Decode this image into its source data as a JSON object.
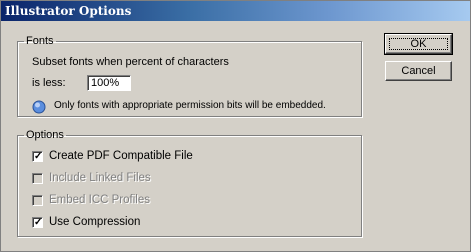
{
  "window": {
    "title": "Illustrator Options"
  },
  "fonts": {
    "legend": "Fonts",
    "subset_label": "Subset fonts when percent of characters",
    "is_less_label": "is less:",
    "threshold_value": "100%",
    "info_text": "Only fonts with appropriate permission bits will be embedded.",
    "info_icon": "info-icon"
  },
  "options": {
    "legend": "Options",
    "items": [
      {
        "label": "Create PDF Compatible File",
        "checked": true,
        "enabled": true
      },
      {
        "label": "Include Linked Files",
        "checked": false,
        "enabled": false
      },
      {
        "label": "Embed ICC Profiles",
        "checked": false,
        "enabled": false
      },
      {
        "label": "Use Compression",
        "checked": true,
        "enabled": true
      }
    ]
  },
  "buttons": {
    "ok": "OK",
    "cancel": "Cancel"
  }
}
